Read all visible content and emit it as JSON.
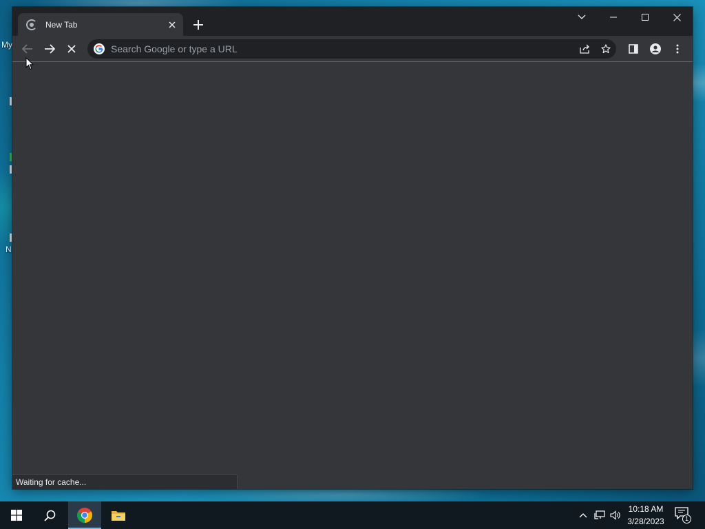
{
  "desktop": {
    "icon_labels": [
      {
        "text": "My"
      },
      {
        "text": "N"
      }
    ]
  },
  "browser": {
    "tab": {
      "title": "New Tab",
      "favicon": "chrome-newtab-icon",
      "close_icon": "close-icon"
    },
    "new_tab_icon": "plus-icon",
    "window_controls": {
      "tab_search_icon": "chevron-down-icon",
      "minimize_icon": "minimize-icon",
      "maximize_icon": "maximize-icon",
      "close_icon": "close-icon"
    },
    "toolbar": {
      "back_icon": "arrow-left-icon",
      "forward_icon": "arrow-right-icon",
      "stop_icon": "stop-loading-icon",
      "omnibox_placeholder": "Search Google or type a URL",
      "omnibox_value": "",
      "share_icon": "share-icon",
      "bookmark_icon": "star-icon",
      "side_panel_icon": "side-panel-icon",
      "profile_icon": "profile-icon",
      "menu_icon": "kebab-menu-icon"
    },
    "status_text": "Waiting for cache...",
    "colors": {
      "frame": "#202124",
      "toolbar": "#35363a",
      "omnibox": "#202124",
      "text": "#e8eaed",
      "placeholder": "#9aa0a6"
    }
  },
  "taskbar": {
    "start_icon": "windows-start-icon",
    "search_icon": "search-icon",
    "apps": [
      {
        "name": "Google Chrome",
        "icon": "chrome-icon",
        "active": true
      },
      {
        "name": "File Explorer",
        "icon": "folder-icon",
        "active": false
      }
    ],
    "tray": {
      "overflow_icon": "chevron-up-icon",
      "network_icon": "network-icon",
      "volume_icon": "speaker-icon"
    },
    "clock": {
      "time": "10:18 AM",
      "date": "3/28/2023"
    },
    "notifications": {
      "icon": "notification-icon",
      "count": "1"
    }
  }
}
